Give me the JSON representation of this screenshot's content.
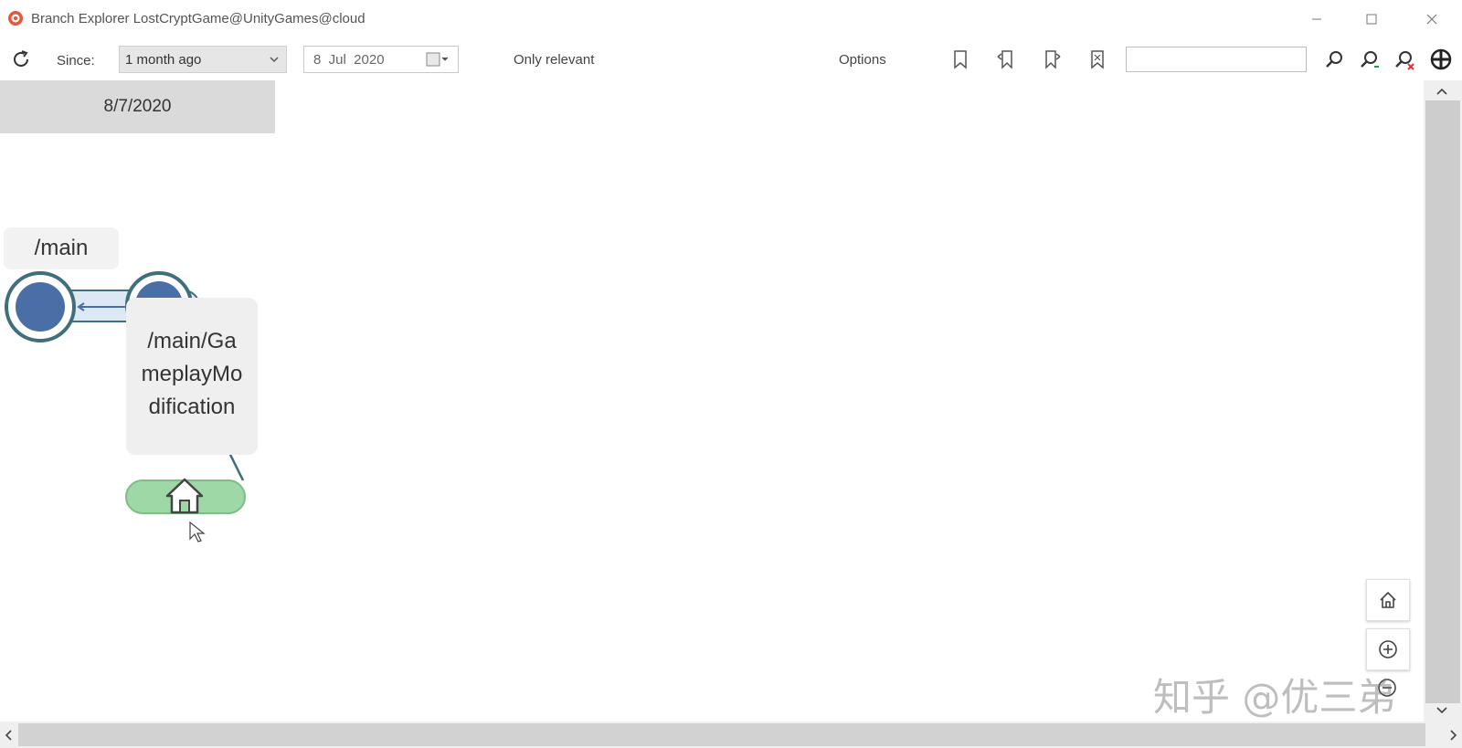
{
  "window": {
    "title": "Branch Explorer LostCryptGame@UnityGames@cloud",
    "controls": [
      "minimize",
      "maximize",
      "close"
    ]
  },
  "toolbar": {
    "refresh_icon": "refresh-icon",
    "since_label": "Since:",
    "since_value": "1 month ago",
    "date_value": "8  Jul  2020",
    "only_relevant": "Only relevant",
    "options": "Options",
    "bookmark_icons": [
      "bookmark-icon",
      "bookmark-back-icon",
      "bookmark-forward-icon",
      "bookmark-clear-icon"
    ],
    "search_value": "",
    "search_icons": [
      "search-icon",
      "search-next-icon",
      "search-clear-icon",
      "navigate-icon"
    ]
  },
  "explorer": {
    "date_header": "8/7/2020",
    "main_branch": "/main",
    "child_branch_lines": [
      "/main/Ga",
      "meplayMo",
      "dification"
    ]
  },
  "zoom_controls": [
    "home-icon",
    "zoom-in-icon",
    "zoom-out-icon"
  ],
  "watermark": "知乎 @优三弟",
  "colors": {
    "changeset_fill": "#4a6fa6",
    "branch_line": "#3f6f7a",
    "workspace_fill": "#9ed8a6",
    "date_header_bg": "#dadada"
  }
}
